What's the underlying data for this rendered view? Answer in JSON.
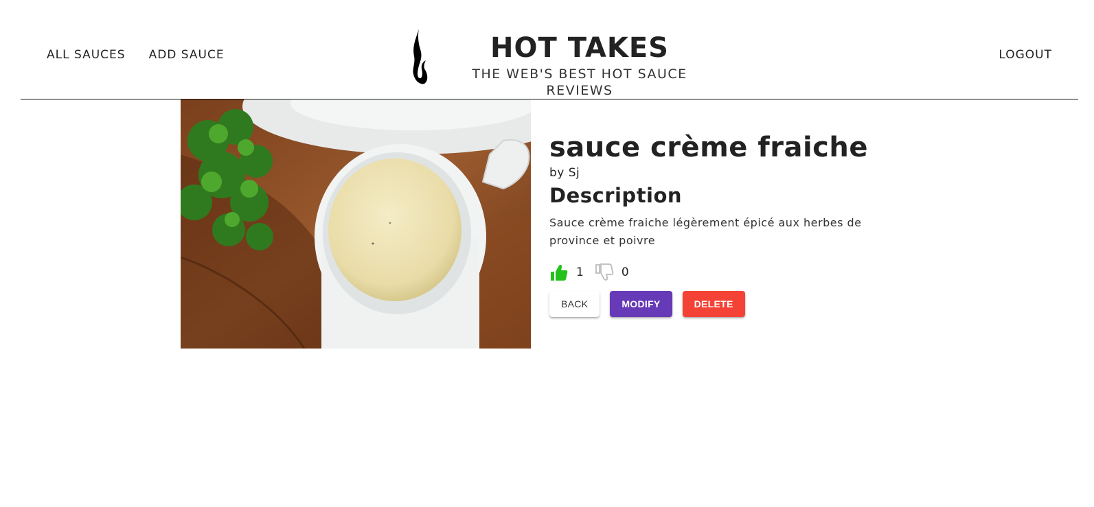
{
  "nav": {
    "all_sauces": "ALL SAUCES",
    "add_sauce": "ADD SAUCE",
    "logout": "LOGOUT"
  },
  "brand": {
    "title": "HOT TAKES",
    "tagline": "THE WEB'S BEST HOT SAUCE REVIEWS",
    "logo_icon": "flame-icon"
  },
  "sauce": {
    "name": "sauce crème fraiche",
    "author": "by Sj",
    "description_heading": "Description",
    "description": "Sauce crème fraiche légèrement épicé aux herbes de province et poivre",
    "likes": "1",
    "dislikes": "0",
    "like_icon": "thumbs-up-icon",
    "dislike_icon": "thumbs-down-icon"
  },
  "buttons": {
    "back": "BACK",
    "modify": "MODIFY",
    "delete": "DELETE"
  },
  "colors": {
    "like": "#22c21a",
    "dislike": "#bbbbbb",
    "modify": "#673ab7",
    "delete": "#f44336"
  }
}
